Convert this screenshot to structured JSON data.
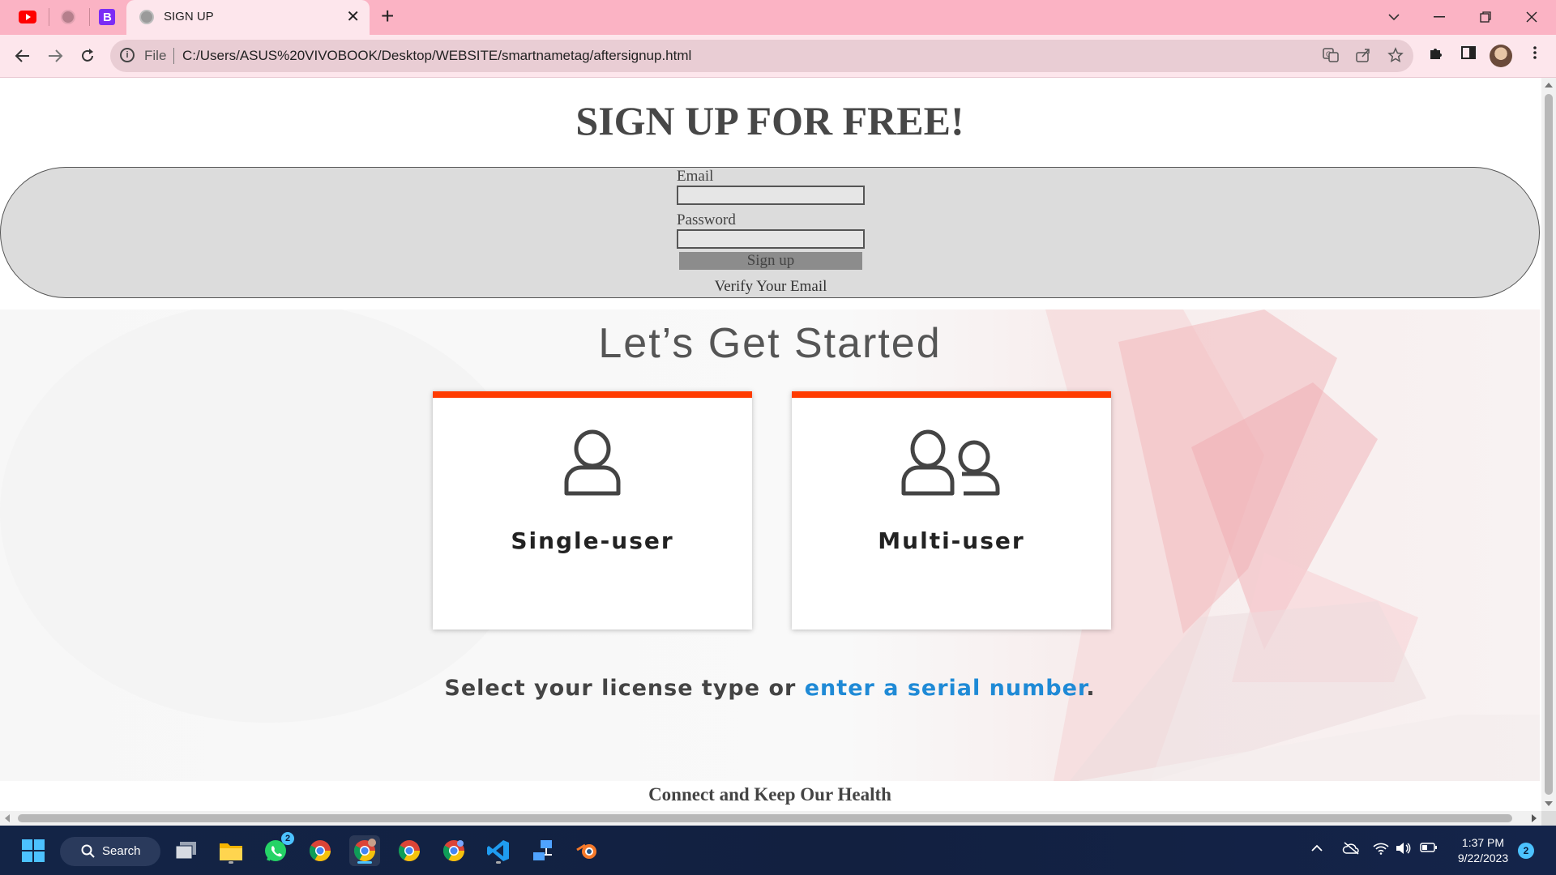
{
  "browser": {
    "tab_title": "SIGN UP",
    "close_glyph": "✕",
    "new_tab_glyph": "+",
    "url_scheme": "File",
    "url": "C:/Users/ASUS%20VIVOBOOK/Desktop/WEBSITE/smartnametag/aftersignup.html",
    "pinned_tabs": [
      "youtube-icon",
      "globe-icon",
      "bootstrap-icon"
    ],
    "toolbar_icons": [
      "translate-icon",
      "share-icon",
      "bookmark-star-icon",
      "extensions-icon",
      "side-panel-icon",
      "profile-avatar",
      "menu-icon"
    ],
    "colors": {
      "tabbar": "#fbb3c4",
      "toolbar": "#fde6ec"
    }
  },
  "page": {
    "title": "SIGN UP FOR FREE!",
    "form": {
      "email_label": "Email",
      "email_value": "",
      "password_label": "Password",
      "password_value": "",
      "submit_label": "Sign up",
      "verify_text": "Verify Your Email"
    },
    "hero": {
      "title": "Let’s Get Started",
      "cards": [
        {
          "label": "Single-user",
          "icon": "single-user-icon"
        },
        {
          "label": "Multi-user",
          "icon": "multi-user-icon"
        }
      ],
      "license_text_prefix": "Select your license type or ",
      "license_link": "enter a serial number",
      "license_text_suffix": ".",
      "colors": {
        "card_accent": "#ff3b00",
        "link": "#1f8ad6"
      }
    },
    "footer_text": "Connect and Keep Our Health"
  },
  "taskbar": {
    "search_label": "Search",
    "apps": [
      "start-icon",
      "search-icon",
      "task-view-icon",
      "file-explorer-icon",
      "whatsapp-icon",
      "chrome-icon",
      "chrome-icon",
      "chrome-icon",
      "chrome-icon",
      "vscode-icon",
      "network-icon",
      "blender-icon"
    ],
    "whatsapp_badge": "2",
    "time": "1:37 PM",
    "date": "9/22/2023",
    "notification_count": "2"
  }
}
